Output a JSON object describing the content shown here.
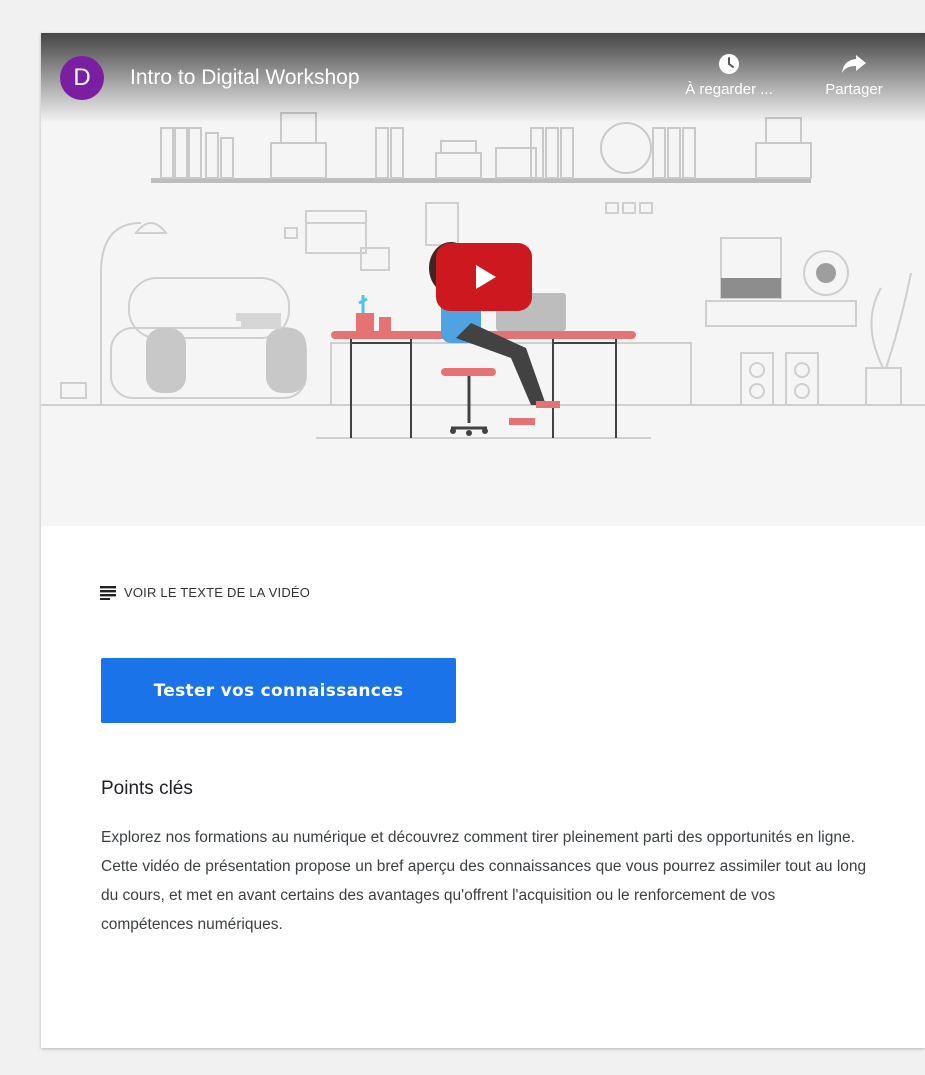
{
  "video": {
    "channel_initial": "D",
    "title": "Intro to Digital Workshop",
    "watch_later_label": "À regarder ...",
    "share_label": "Partager",
    "avatar_color": "#7b1fa2",
    "play_button_color": "#cc181e"
  },
  "transcript": {
    "label": "VOIR LE TEXTE DE LA VIDÉO"
  },
  "cta": {
    "label": "Tester vos connaissances",
    "color": "#1a73e8"
  },
  "key_points": {
    "heading": "Points clés",
    "body": "Explorez nos formations au numérique et découvrez comment tirer pleinement parti des opportunités en ligne. Cette vidéo de présentation propose un bref aperçu des connaissances que vous pourrez assimiler tout au long du cours, et met en avant certains des avantages qu'offrent l'acquisition ou le renforcement de vos compétences numériques."
  },
  "icons": {
    "watch_later": "clock-icon",
    "share": "share-arrow-icon",
    "play": "play-icon",
    "transcript": "lines-icon"
  }
}
